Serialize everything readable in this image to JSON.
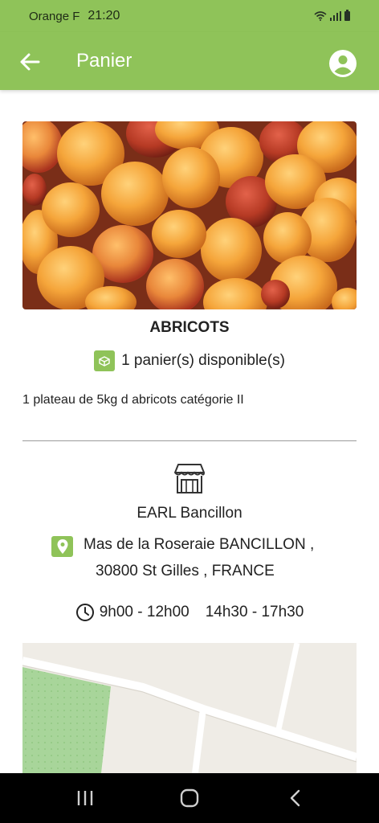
{
  "status_bar": {
    "carrier": "Orange F",
    "time": "21:20",
    "icons": [
      "wifi-icon",
      "signal-icon",
      "battery-icon"
    ]
  },
  "app_bar": {
    "title": "Panier",
    "back_icon": "arrow-left-icon",
    "account_icon": "account-circle-icon"
  },
  "product": {
    "image": "apricots-photo",
    "name": "ABRICOTS",
    "availability": "1 panier(s) disponible(s)",
    "description": "1 plateau de 5kg d abricots catégorie II"
  },
  "producer": {
    "icon": "store-icon",
    "name": "EARL Bancillon",
    "address_line1": "Mas de la Roseraie BANCILLON ,",
    "address_line2": "30800 St Gilles , FRANCE",
    "hours_morning": "9h00 - 12h00",
    "hours_afternoon": "14h30 - 17h30"
  },
  "map": {
    "description": "map-preview"
  },
  "nav_bar": {
    "buttons": [
      "recent-apps-icon",
      "home-icon",
      "back-icon"
    ]
  },
  "colors": {
    "accent": "#8fc359",
    "text": "#222222",
    "divider": "#9a9a9a",
    "map_bg": "#efece6",
    "map_park": "#a8d59a"
  }
}
